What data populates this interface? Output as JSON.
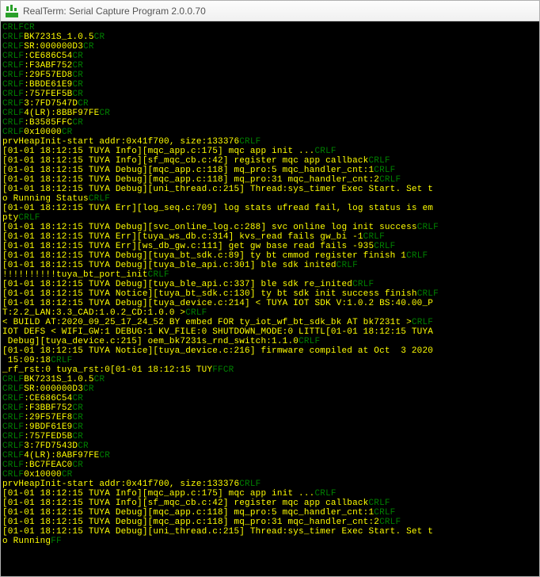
{
  "window": {
    "title": "RealTerm: Serial Capture Program 2.0.0.70",
    "icon": "realterm-icon"
  },
  "control_chars": {
    "cr": "CR",
    "lf": "LF",
    "crlf": "CRLF",
    "ff": "FF"
  },
  "terminal": {
    "lines": [
      {
        "pre": "crlf",
        "text": "",
        "post": "cr"
      },
      {
        "pre": "crlf",
        "text": "BK7231S_1.0.5",
        "post": "cr"
      },
      {
        "pre": "crlf",
        "text": "SR:000000D3",
        "post": "cr"
      },
      {
        "pre": "crlf",
        "text": ":CE686C54",
        "post": "cr"
      },
      {
        "pre": "crlf",
        "text": ":F3ABF752",
        "post": "cr"
      },
      {
        "pre": "crlf",
        "text": ":29F57ED8",
        "post": "cr"
      },
      {
        "pre": "crlf",
        "text": ":BBDE61E9",
        "post": "cr"
      },
      {
        "pre": "crlf",
        "text": ":757FEF5B",
        "post": "cr"
      },
      {
        "pre": "crlf",
        "text": "3:7FD7547D",
        "post": "cr"
      },
      {
        "pre": "crlf",
        "text": "4(LR):8BBF97FE",
        "post": "cr"
      },
      {
        "pre": "crlf",
        "text": ":B3585FFC",
        "post": "cr"
      },
      {
        "pre": "crlf",
        "text": "0x10000",
        "post": "cr"
      },
      {
        "text": "prvHeapInit-start addr:0x41f700, size:133376",
        "post": "crlf"
      },
      {
        "text": "[01-01 18:12:15 TUYA Info][mqc_app.c:175] mqc app init ...",
        "post": "crlf"
      },
      {
        "text": "[01-01 18:12:15 TUYA Info][sf_mqc_cb.c:42] register mqc app callback",
        "post": "crlf"
      },
      {
        "text": "[01-01 18:12:15 TUYA Debug][mqc_app.c:118] mq_pro:5 mqc_handler_cnt:1",
        "post": "crlf"
      },
      {
        "text": "[01-01 18:12:15 TUYA Debug][mqc_app.c:118] mq_pro:31 mqc_handler_cnt:2",
        "post": "crlf"
      },
      {
        "text": "[01-01 18:12:15 TUYA Debug][uni_thread.c:215] Thread:sys_timer Exec Start. Set t"
      },
      {
        "text": "o Running Status",
        "post": "crlf"
      },
      {
        "text": "[01-01 18:12:15 TUYA Err][log_seq.c:709] log stats ufread fail, log status is em"
      },
      {
        "text": "pty",
        "post": "crlf"
      },
      {
        "text": "[01-01 18:12:15 TUYA Debug][svc_online_log.c:288] svc online log init success",
        "post": "crlf"
      },
      {
        "text": "[01-01 18:12:15 TUYA Err][tuya_ws_db.c:314] kvs_read fails gw_bi -1",
        "post": "crlf"
      },
      {
        "text": "[01-01 18:12:15 TUYA Err][ws_db_gw.c:111] get gw base read fails -935",
        "post": "crlf"
      },
      {
        "text": "[01-01 18:12:15 TUYA Debug][tuya_bt_sdk.c:89] ty bt cmmod register finish 1",
        "post": "crlf"
      },
      {
        "text": "[01-01 18:12:15 TUYA Debug][tuya_ble_api.c:301] ble sdk inited",
        "post": "crlf"
      },
      {
        "text": "!!!!!!!!!!tuya_bt_port_init",
        "post": "crlf"
      },
      {
        "text": "[01-01 18:12:15 TUYA Debug][tuya_ble_api.c:337] ble sdk re_inited",
        "post": "crlf"
      },
      {
        "text": "[01-01 18:12:15 TUYA Notice][tuya_bt_sdk.c:130] ty bt sdk init success finish",
        "post": "crlf"
      },
      {
        "text": "[01-01 18:12:15 TUYA Debug][tuya_device.c:214] < TUYA IOT SDK V:1.0.2 BS:40.00_P"
      },
      {
        "text": "T:2.2_LAN:3.3_CAD:1.0.2_CD:1.0.0 >",
        "post": "crlf"
      },
      {
        "text": "< BUILD AT:2020_09_25_17_24_52 BY embed FOR ty_iot_wf_bt_sdk_bk AT bk7231t >",
        "post": "crlf"
      },
      {
        "text": "IOT DEFS < WIFI_GW:1 DEBUG:1 KV_FILE:0 SHUTDOWN_MODE:0 LITTL[01-01 18:12:15 TUYA"
      },
      {
        "text": " Debug][tuya_device.c:215] oem_bk7231s_rnd_switch:1.1.0",
        "post": "crlf"
      },
      {
        "text": "[01-01 18:12:15 TUYA Notice][tuya_device.c:216] firmware compiled at Oct  3 2020"
      },
      {
        "text": " 15:09:18",
        "post": "crlf"
      },
      {
        "text": "_rf_rst:0 tuya_rst:0[01-01 18:12:15 TUY",
        "post": "ffcr"
      },
      {
        "pre": "crlf",
        "text": "BK7231S_1.0.5",
        "post": "cr"
      },
      {
        "pre": "crlf",
        "text": "SR:000000D3",
        "post": "cr"
      },
      {
        "pre": "crlf",
        "text": ":CE686C54",
        "post": "cr"
      },
      {
        "pre": "crlf",
        "text": ":F3BBF752",
        "post": "cr"
      },
      {
        "pre": "crlf",
        "text": ":29F57EF8",
        "post": "cr"
      },
      {
        "pre": "crlf",
        "text": ":9BDF61E9",
        "post": "cr"
      },
      {
        "pre": "crlf",
        "text": ":757FED5B",
        "post": "cr"
      },
      {
        "pre": "crlf",
        "text": "3:7FD7543D",
        "post": "cr"
      },
      {
        "pre": "crlf",
        "text": "4(LR):8ABF97FE",
        "post": "cr"
      },
      {
        "pre": "crlf",
        "text": ":BC7FEAC0",
        "post": "cr"
      },
      {
        "pre": "crlf",
        "text": "0x10000",
        "post": "cr"
      },
      {
        "text": "prvHeapInit-start addr:0x41f700, size:133376",
        "post": "crlf"
      },
      {
        "text": "[01-01 18:12:15 TUYA Info][mqc_app.c:175] mqc app init ...",
        "post": "crlf"
      },
      {
        "text": "[01-01 18:12:15 TUYA Info][sf_mqc_cb.c:42] register mqc app callback",
        "post": "crlf"
      },
      {
        "text": "[01-01 18:12:15 TUYA Debug][mqc_app.c:118] mq_pro:5 mqc_handler_cnt:1",
        "post": "crlf"
      },
      {
        "text": "[01-01 18:12:15 TUYA Debug][mqc_app.c:118] mq_pro:31 mqc_handler_cnt:2",
        "post": "crlf"
      },
      {
        "text": "[01-01 18:12:15 TUYA Debug][uni_thread.c:215] Thread:sys_timer Exec Start. Set t"
      },
      {
        "text": "o Running",
        "post": "ff"
      }
    ]
  }
}
